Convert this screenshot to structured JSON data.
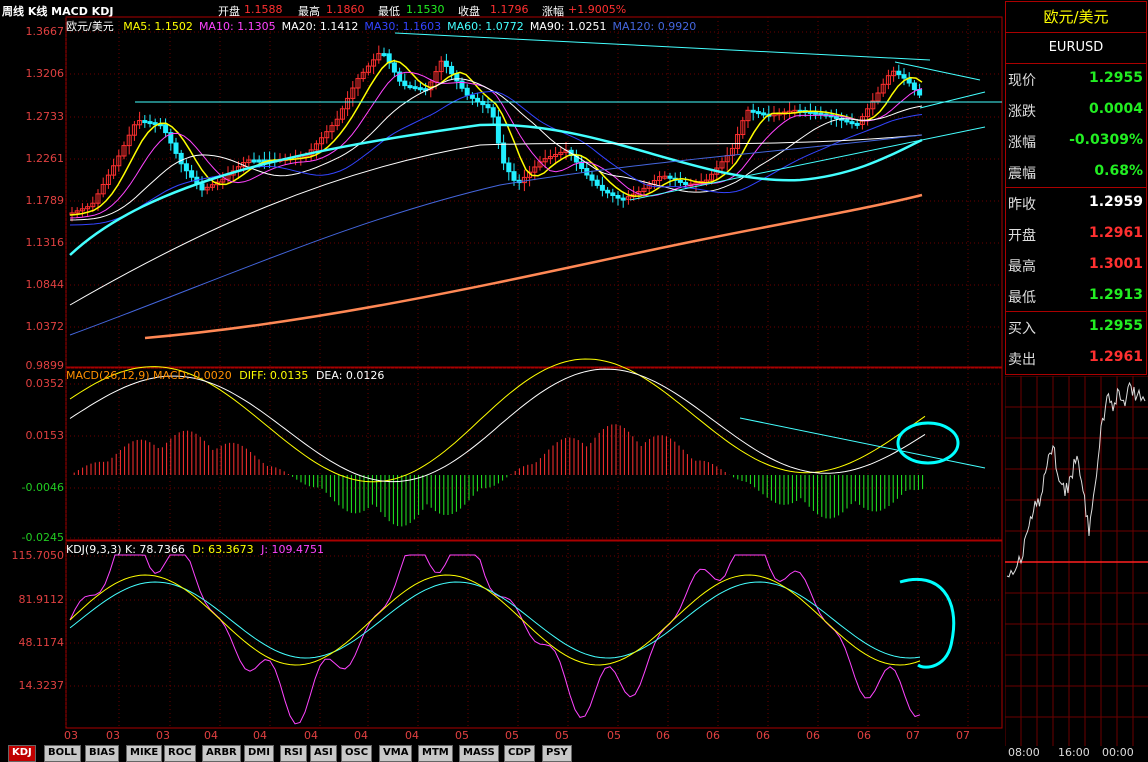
{
  "header": {
    "chart_type_label": "周线 K线 MACD KDJ",
    "open_label": "开盘",
    "open_value": "1.1588",
    "high_label": "最高",
    "high_value": "1.1860",
    "low_label": "最低",
    "low_value": "1.1530",
    "close_label": "收盘",
    "close_value": "1.1796",
    "change_label": "涨幅",
    "change_value": "+1.9005%"
  },
  "price_panel": {
    "symbol_name": "欧元/美元",
    "ma_labels": [
      {
        "text": "MA5: 1.1502",
        "color": "#ffff00"
      },
      {
        "text": "MA10: 1.1305",
        "color": "#ff44ff"
      },
      {
        "text": "MA20: 1.1412",
        "color": "#ffffff"
      },
      {
        "text": "MA30: 1.1603",
        "color": "#3344ff"
      },
      {
        "text": "MA60: 1.0772",
        "color": "#44ffff"
      },
      {
        "text": "MA90: 1.0251",
        "color": "#ffffff"
      },
      {
        "text": "MA120: 0.9920",
        "color": "#4466dd"
      }
    ],
    "y_ticks": [
      "1.3667",
      "1.3206",
      "1.2733",
      "1.2261",
      "1.1789",
      "1.1316",
      "1.0844",
      "1.0372",
      "0.9899"
    ]
  },
  "macd_panel": {
    "title": "MACD(26,12,9)",
    "macd": "MACD: 0.0020",
    "diff": "DIFF: 0.0135",
    "dea": "DEA: 0.0126",
    "y_ticks": [
      "0.0352",
      "0.0153",
      "-0.0046",
      "-0.0245"
    ]
  },
  "kdj_panel": {
    "title": "KDJ(9,3,3)",
    "k": "K: 78.7366",
    "d": "D: 63.3673",
    "j": "J: 109.4751",
    "y_ticks": [
      "115.7050",
      "81.9112",
      "48.1174",
      "14.3237"
    ]
  },
  "x_axis_labels": [
    "03",
    "03",
    "03",
    "04",
    "04",
    "04",
    "04",
    "04",
    "05",
    "05",
    "05",
    "05",
    "06",
    "06",
    "06",
    "06",
    "06",
    "07",
    "07"
  ],
  "quote_panel": {
    "title": "欧元/美元",
    "code": "EURUSD",
    "rows": [
      {
        "label": "现价",
        "value": "1.2955",
        "color": "#22ee22"
      },
      {
        "label": "涨跌",
        "value": "0.0004",
        "color": "#22ee22"
      },
      {
        "label": "涨幅",
        "value": "-0.0309%",
        "color": "#22ee22"
      },
      {
        "label": "震幅",
        "value": "0.68%",
        "color": "#22ee22"
      },
      {
        "label": "昨收",
        "value": "1.2959",
        "color": "#ffffff"
      },
      {
        "label": "开盘",
        "value": "1.2961",
        "color": "#ff3030"
      },
      {
        "label": "最高",
        "value": "1.3001",
        "color": "#ff3030"
      },
      {
        "label": "最低",
        "value": "1.2913",
        "color": "#22ee22"
      },
      {
        "label": "买入",
        "value": "1.2955",
        "color": "#22ee22"
      },
      {
        "label": "卖出",
        "value": "1.2961",
        "color": "#ff3030"
      }
    ]
  },
  "mini_chart_times": [
    "08:00",
    "16:00",
    "00:00"
  ],
  "tabs": [
    "KDJ",
    "BOLL",
    "BIAS",
    "MIKE",
    "ROC",
    "ARBR",
    "DMI",
    "RSI",
    "ASI",
    "OSC",
    "VMA",
    "MTM",
    "MASS",
    "CDP",
    "PSY"
  ],
  "colors": {
    "up": "#ff3030",
    "down": "#22ee22",
    "grid": "#8b0000",
    "border": "#aa0000"
  }
}
